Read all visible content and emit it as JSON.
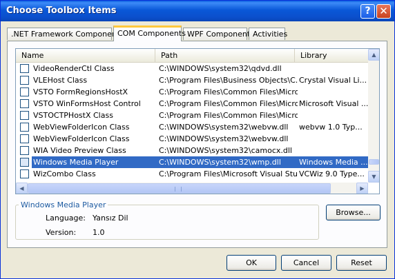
{
  "window": {
    "title": "Choose Toolbox Items",
    "help_glyph": "?",
    "close_glyph": "✕"
  },
  "tabs": [
    {
      "label": ".NET Framework Components",
      "active": false
    },
    {
      "label": "COM Components",
      "active": true
    },
    {
      "label": "WPF Components",
      "active": false
    },
    {
      "label": "Activities",
      "active": false
    }
  ],
  "columns": {
    "name": "Name",
    "path": "Path",
    "library": "Library"
  },
  "rows": [
    {
      "name": "VideoRenderCtl Class",
      "path": "C:\\WINDOWS\\system32\\qdvd.dll",
      "library": ""
    },
    {
      "name": "VLEHost Class",
      "path": "C:\\Program Files\\Business Objects\\C...",
      "library": "Crystal Visual Li..."
    },
    {
      "name": "VSTO FormRegionsHostX",
      "path": "C:\\Program Files\\Common Files\\Micro...",
      "library": ""
    },
    {
      "name": "VSTO WinFormsHost Control",
      "path": "C:\\Program Files\\Common Files\\Micro...",
      "library": "Microsoft Visual ..."
    },
    {
      "name": "VSTOCTPHostX Class",
      "path": "C:\\Program Files\\Common Files\\Micro...",
      "library": ""
    },
    {
      "name": "WebViewFolderIcon Class",
      "path": "C:\\WINDOWS\\system32\\webvw.dll",
      "library": "webvw 1.0 Typ..."
    },
    {
      "name": "WebViewFolderIcon Class",
      "path": "C:\\WINDOWS\\system32\\webvw.dll",
      "library": ""
    },
    {
      "name": "WIA Video Preview Class",
      "path": "C:\\WINDOWS\\system32\\camocx.dll",
      "library": ""
    },
    {
      "name": "Windows Media Player",
      "path": "C:\\WINDOWS\\system32\\wmp.dll",
      "library": "Windows Media ..."
    },
    {
      "name": "WizCombo Class",
      "path": "C:\\Program Files\\Microsoft Visual Stu...",
      "library": "VCWiz 9.0 Type..."
    }
  ],
  "selected_row_index": 8,
  "scroll": {
    "up": "▲",
    "down": "▼",
    "left": "◀",
    "right": "▶"
  },
  "details": {
    "title": "Windows Media Player",
    "language_label": "Language:",
    "language_value": "Yansız Dil",
    "version_label": "Version:",
    "version_value": "1.0"
  },
  "buttons": {
    "browse": "Browse...",
    "ok": "OK",
    "cancel": "Cancel",
    "reset": "Reset"
  }
}
